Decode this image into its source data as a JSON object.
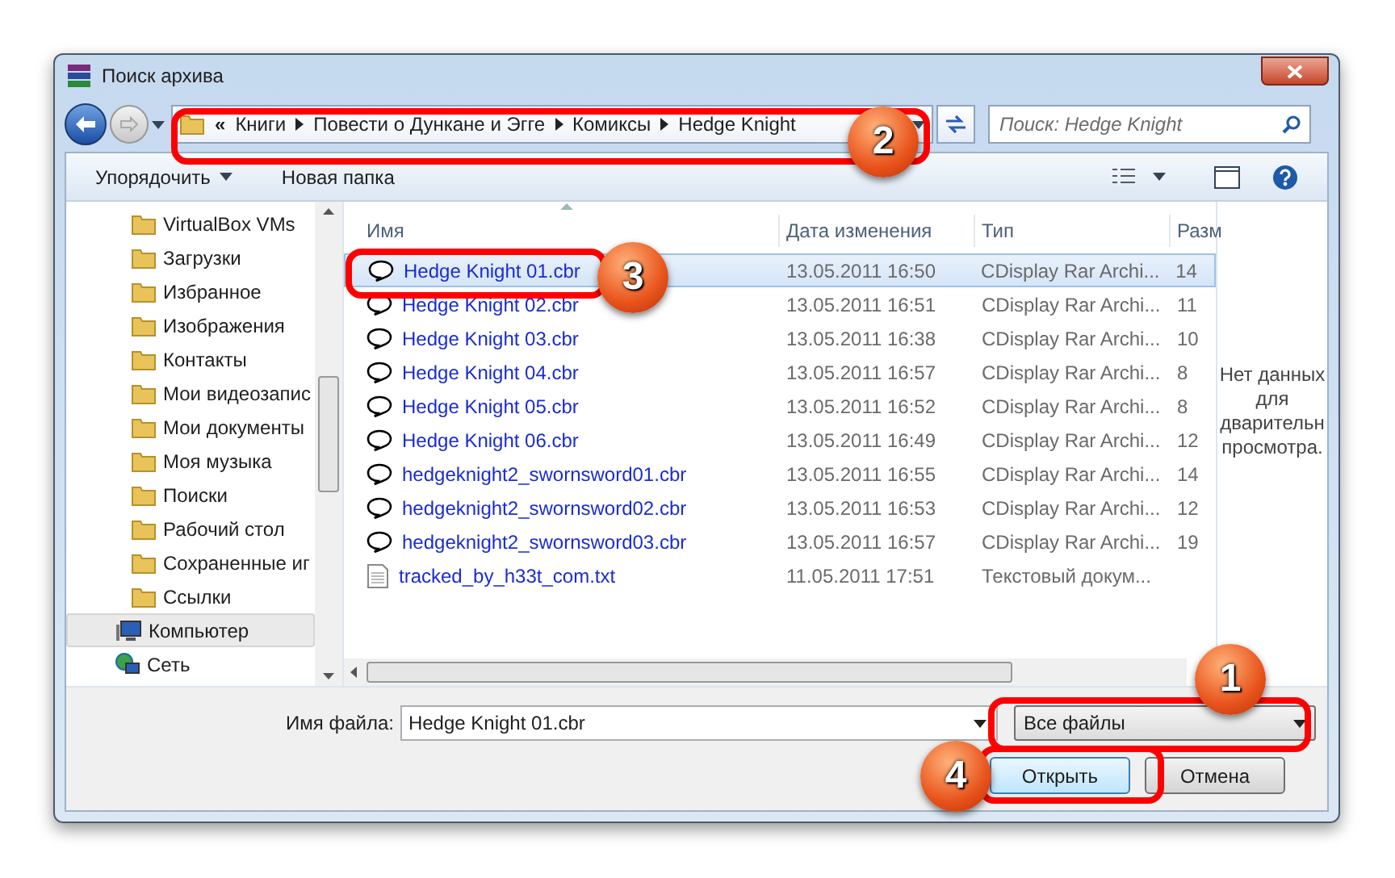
{
  "window": {
    "title": "Поиск архива"
  },
  "address": {
    "overflow": "«",
    "crumbs": [
      "Книги",
      "Повести о Дункане и Эгге",
      "Комиксы",
      "Hedge Knight"
    ]
  },
  "search": {
    "placeholder": "Поиск: Hedge Knight"
  },
  "toolbar": {
    "organize": "Упорядочить",
    "new_folder": "Новая папка"
  },
  "sidebar": {
    "items": [
      {
        "label": "VirtualBox VMs",
        "kind": "folder",
        "selected": false
      },
      {
        "label": "Загрузки",
        "kind": "folder",
        "selected": false
      },
      {
        "label": "Избранное",
        "kind": "folder",
        "selected": false
      },
      {
        "label": "Изображения",
        "kind": "folder",
        "selected": false
      },
      {
        "label": "Контакты",
        "kind": "folder",
        "selected": false
      },
      {
        "label": "Мои видеозапис",
        "kind": "folder",
        "selected": false
      },
      {
        "label": "Мои документы",
        "kind": "folder",
        "selected": false
      },
      {
        "label": "Моя музыка",
        "kind": "folder",
        "selected": false
      },
      {
        "label": "Поиски",
        "kind": "folder",
        "selected": false
      },
      {
        "label": "Рабочий стол",
        "kind": "folder",
        "selected": false
      },
      {
        "label": "Сохраненные иг",
        "kind": "folder",
        "selected": false
      },
      {
        "label": "Ссылки",
        "kind": "folder",
        "selected": false
      },
      {
        "label": "Компьютер",
        "kind": "computer",
        "selected": true
      },
      {
        "label": "Сеть",
        "kind": "network",
        "selected": false
      }
    ]
  },
  "table": {
    "columns": [
      "Имя",
      "Дата изменения",
      "Тип",
      "Разм"
    ],
    "rows": [
      {
        "name": "Hedge Knight 01.cbr",
        "date": "13.05.2011 16:50",
        "type": "CDisplay Rar Archi...",
        "size": "14",
        "kind": "archive",
        "selected": true
      },
      {
        "name": "Hedge Knight 02.cbr",
        "date": "13.05.2011 16:51",
        "type": "CDisplay Rar Archi...",
        "size": "11",
        "kind": "archive",
        "selected": false
      },
      {
        "name": "Hedge Knight 03.cbr",
        "date": "13.05.2011 16:38",
        "type": "CDisplay Rar Archi...",
        "size": "10",
        "kind": "archive",
        "selected": false
      },
      {
        "name": "Hedge Knight 04.cbr",
        "date": "13.05.2011 16:57",
        "type": "CDisplay Rar Archi...",
        "size": "8",
        "kind": "archive",
        "selected": false
      },
      {
        "name": "Hedge Knight 05.cbr",
        "date": "13.05.2011 16:52",
        "type": "CDisplay Rar Archi...",
        "size": "8",
        "kind": "archive",
        "selected": false
      },
      {
        "name": "Hedge Knight 06.cbr",
        "date": "13.05.2011 16:49",
        "type": "CDisplay Rar Archi...",
        "size": "12",
        "kind": "archive",
        "selected": false
      },
      {
        "name": "hedgeknight2_swornsword01.cbr",
        "date": "13.05.2011 16:55",
        "type": "CDisplay Rar Archi...",
        "size": "14",
        "kind": "archive",
        "selected": false
      },
      {
        "name": "hedgeknight2_swornsword02.cbr",
        "date": "13.05.2011 16:53",
        "type": "CDisplay Rar Archi...",
        "size": "12",
        "kind": "archive",
        "selected": false
      },
      {
        "name": "hedgeknight2_swornsword03.cbr",
        "date": "13.05.2011 16:57",
        "type": "CDisplay Rar Archi...",
        "size": "19",
        "kind": "archive",
        "selected": false
      },
      {
        "name": "tracked_by_h33t_com.txt",
        "date": "11.05.2011 17:51",
        "type": "Текстовый докум...",
        "kind": "text",
        "selected": false
      }
    ]
  },
  "preview": {
    "lines": [
      "Нет данных",
      "для",
      "дварительн",
      "просмотра."
    ]
  },
  "filename": {
    "label": "Имя файла:",
    "value": "Hedge Knight 01.cbr"
  },
  "filetype": {
    "value": "Все файлы"
  },
  "buttons": [
    "Открыть",
    "Отмена"
  ],
  "callouts": [
    "1",
    "2",
    "3",
    "4"
  ]
}
